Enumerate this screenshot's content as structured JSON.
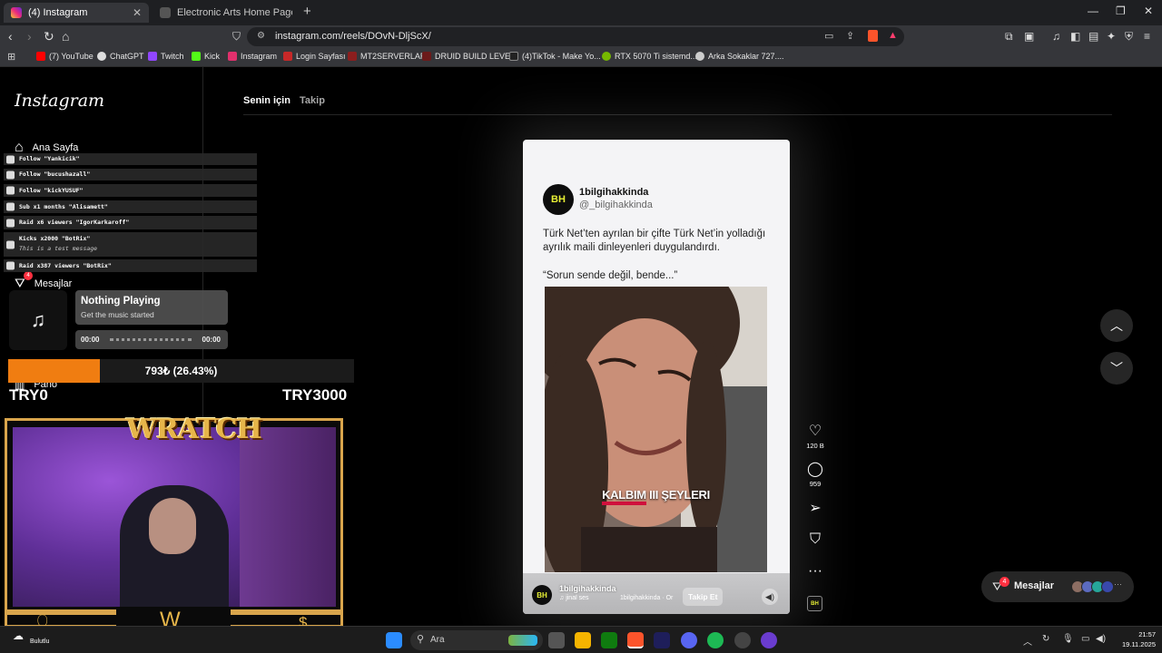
{
  "browser": {
    "tabs": [
      {
        "title": "(4) Instagram",
        "active": true
      },
      {
        "title": "Electronic Arts Home Page - Official",
        "active": false
      }
    ],
    "url": "instagram.com/reels/DOvN-DljScX/",
    "bookmarks": [
      {
        "label": "(7) YouTube",
        "color": "#ff0000"
      },
      {
        "label": "ChatGPT",
        "color": "#dddddd"
      },
      {
        "label": "Twitch",
        "color": "#9146ff"
      },
      {
        "label": "Kick",
        "color": "#53fc18"
      },
      {
        "label": "Instagram",
        "color": "#e1306c"
      },
      {
        "label": "Login Sayfası",
        "color": "#c62828"
      },
      {
        "label": "MT2SERVERLAR",
        "color": "#8b1e1e"
      },
      {
        "label": "DRUID BUILD LEVEL",
        "color": "#6b1a1a"
      },
      {
        "label": "(4)TikTok - Make Yo...",
        "color": "#222222"
      },
      {
        "label": "RTX 5070 Ti sistemd...",
        "color": "#76b900"
      },
      {
        "label": "Arka Sokaklar 727....",
        "color": "#cccccc"
      }
    ]
  },
  "instagram": {
    "logo": "Instagram",
    "sidebar": [
      {
        "label": "Ana Sayfa"
      },
      {
        "label": "Mesajlar",
        "badge": "4"
      },
      {
        "label": "Pano"
      }
    ],
    "feed_tabs": [
      "Senin için",
      "Takip"
    ],
    "reel": {
      "avatar_text": "BH",
      "tweet_name": "1bilgihakkinda",
      "tweet_handle": "@_bilgihakkinda",
      "tweet_text": "Türk Net’ten ayrılan bir çifte Türk Net’in yolladığı ayrılık maili dinleyenleri duygulandırdı.",
      "tweet_quote": "“Sorun sende değil, bende...”",
      "caption_prefix": "KALBIM",
      "caption_rest": " III ŞEYLERI",
      "footer_name": "1bilgihakkinda",
      "footer_audio": "♫ jinal ses",
      "footer_audio2": "1bilgihakkinda · Or",
      "follow": "Takip Et"
    },
    "actions": {
      "likes": "120 B",
      "comments": "959"
    },
    "messages_pill": {
      "label": "Mesajlar",
      "badge": "4"
    }
  },
  "overlay": {
    "alerts": [
      {
        "text": "Follow \"Yankicik\""
      },
      {
        "text": "Follow \"bucushazall\""
      },
      {
        "text": "Follow \"kickYUSUF\""
      },
      {
        "text": "Sub x1 months \"Alisamett\""
      },
      {
        "text": "Raid x6 viewers \"IgorKarkaroff\""
      },
      {
        "text": "Kicks x2000 \"BotRix\"",
        "sub": "This is a test message"
      },
      {
        "text": "Raid x387 viewers \"BotRix\""
      }
    ],
    "music": {
      "title": "Nothing Playing",
      "subtitle": "Get the music started",
      "start": "00:00",
      "end": "00:00"
    },
    "goal": {
      "text": "793₺ (26.43%)",
      "fraction": 0.2643,
      "left": "TRY0",
      "right": "TRY3000"
    },
    "logo": "WRATCH"
  },
  "taskbar": {
    "weather": "Bulutlu",
    "search": "Ara",
    "time": "21:57",
    "date": "19.11.2025"
  }
}
